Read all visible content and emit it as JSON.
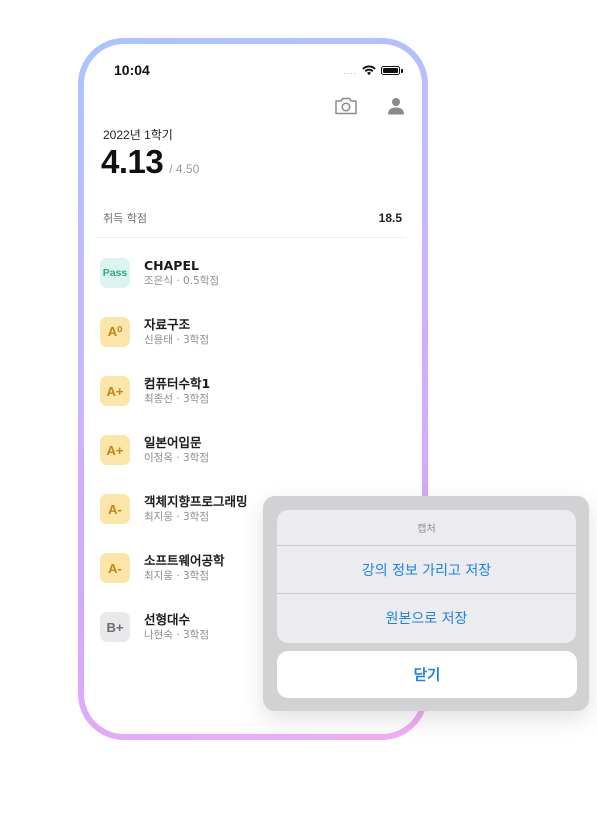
{
  "status_bar": {
    "time": "10:04",
    "signal": "....",
    "icons": [
      "wifi-icon",
      "battery-icon"
    ]
  },
  "header": {
    "icons": [
      "camera-icon",
      "profile-icon"
    ]
  },
  "summary": {
    "semester": "2022년 1학기",
    "gpa": "4.13",
    "gpa_max": "/ 4.50",
    "credits_label": "취득 학점",
    "credits_value": "18.5"
  },
  "courses": [
    {
      "grade": "Pass",
      "name": "CHAPEL",
      "detail": "조은식 · 0.5학점"
    },
    {
      "grade": "A⁰",
      "name": "자료구조",
      "detail": "신용태 · 3학점"
    },
    {
      "grade": "A+",
      "name": "컴퓨터수학1",
      "detail": "최종선 · 3학점"
    },
    {
      "grade": "A+",
      "name": "일본어입문",
      "detail": "이정옥 · 3학점"
    },
    {
      "grade": "A-",
      "name": "객체지향프로그래밍",
      "detail": "최지웅 · 3학점"
    },
    {
      "grade": "A-",
      "name": "소프트웨어공학",
      "detail": "최지웅 · 3학점"
    },
    {
      "grade": "B+",
      "name": "선형대수",
      "detail": "나현숙 · 3학점"
    }
  ],
  "action_sheet": {
    "title": "캡처",
    "actions": [
      "강의 정보 가리고 저장",
      "원본으로 저장"
    ],
    "close": "닫기"
  },
  "colors": {
    "accent": "#1a82e8",
    "grade_a_bg": "#fbe5a9",
    "grade_a_fg": "#c2851a",
    "pass_bg": "#dbf5ee",
    "pass_fg": "#2fa98a"
  }
}
